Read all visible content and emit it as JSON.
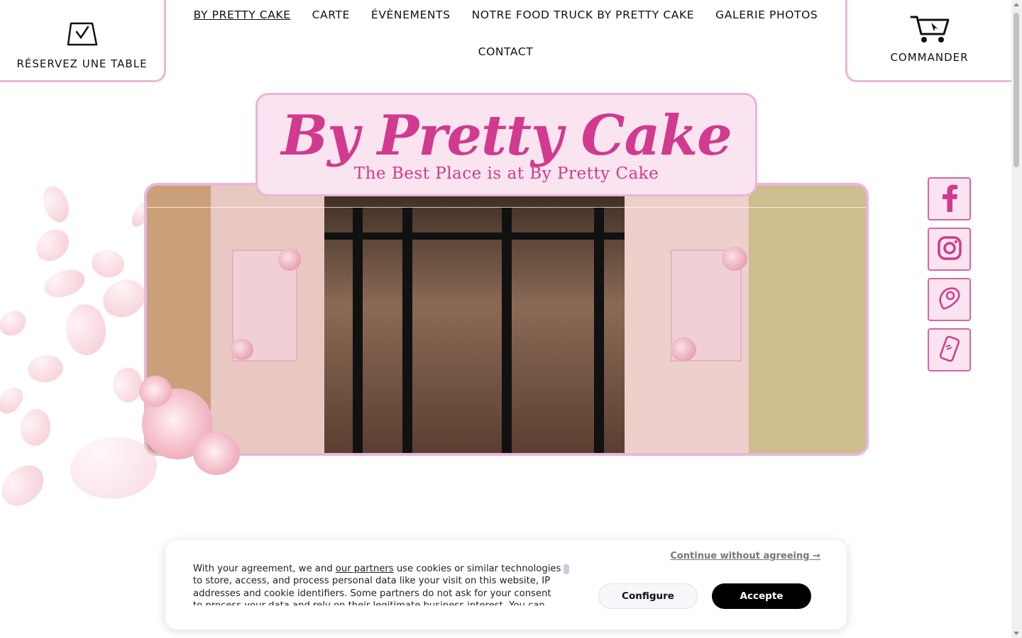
{
  "header": {
    "reserve_label": "RÉSERVEZ UNE TABLE",
    "order_label": "COMMANDER"
  },
  "nav": {
    "items": [
      {
        "label": "BY PRETTY CAKE"
      },
      {
        "label": "CARTE"
      },
      {
        "label": "ÉVÈNEMENTS"
      },
      {
        "label": "NOTRE FOOD TRUCK BY PRETTY CAKE"
      },
      {
        "label": "GALERIE PHOTOS"
      },
      {
        "label": "CONTACT"
      }
    ],
    "active_index": 0
  },
  "logo": {
    "title": "By Pretty Cake",
    "subtitle": "The Best Place is at  By Pretty Cake",
    "color": "#d13a8e",
    "background": "#f9e4ef"
  },
  "social": [
    {
      "icon": "facebook-icon"
    },
    {
      "icon": "instagram-icon"
    },
    {
      "icon": "map-pin-icon"
    },
    {
      "icon": "phone-icon"
    }
  ],
  "cookie": {
    "text_before_link": "With your agreement, we and ",
    "link_text": "our partners",
    "text_after_link": " use cookies or similar technologies to store, access, and process personal data like your visit on this website, IP addresses and cookie identifiers. Some partners do not ask for your consent to process your data and rely on their legitimate business interest. You can",
    "continue_label": "Continue without agreeing →",
    "configure_label": "Configure",
    "accept_label": "Accepte"
  },
  "colors": {
    "accent_pink": "#d13a8e",
    "border_pink": "#e8b7d9",
    "social_border": "#d466a6"
  }
}
